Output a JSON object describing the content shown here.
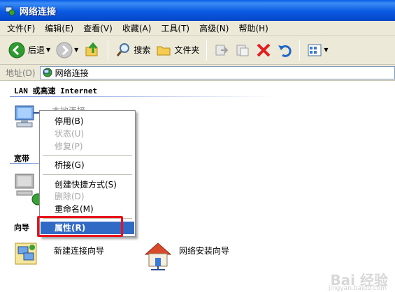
{
  "window": {
    "title": "网络连接"
  },
  "menu": [
    "文件(F)",
    "编辑(E)",
    "查看(V)",
    "收藏(A)",
    "工具(T)",
    "高级(N)",
    "帮助(H)"
  ],
  "toolbar": {
    "back": "后退",
    "search": "搜索",
    "folders": "文件夹"
  },
  "address": {
    "label": "地址(D)",
    "value": "网络连接"
  },
  "groups": {
    "lan": "LAN 或高速 Internet",
    "broadband": "宽带",
    "wizard": "向导"
  },
  "icons": {
    "lan_partial": "本地连接",
    "new_conn_wizard": "新建连接向导",
    "net_setup_wizard": "网络安装向导"
  },
  "context_menu": {
    "disable": "停用(B)",
    "status": "状态(U)",
    "repair": "修复(P)",
    "bridge": "桥接(G)",
    "create_shortcut": "创建快捷方式(S)",
    "delete": "删除(D)",
    "rename": "重命名(M)",
    "properties": "属性(R)"
  },
  "watermark": {
    "brand": "Bai 经验",
    "url": "jingyan.baidu.com"
  },
  "colors": {
    "titlebar": "#0a5ae2",
    "highlight": "#316ac5",
    "annotation": "#e8121c"
  }
}
